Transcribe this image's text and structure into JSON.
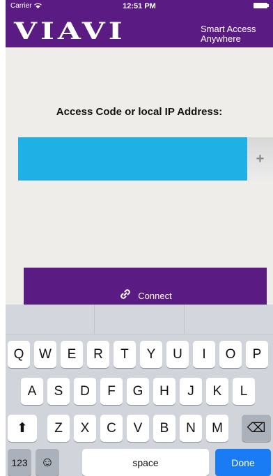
{
  "status_bar": {
    "carrier": "Carrier",
    "time": "12:51 PM"
  },
  "header": {
    "logo": "VIAVI",
    "tagline_line1": "Smart Access",
    "tagline_line2": "Anywhere"
  },
  "main": {
    "access_label": "Access Code or local IP Address:",
    "input_value": "",
    "add_button_label": "+",
    "connect_label": "Connect"
  },
  "keyboard": {
    "row1": [
      "Q",
      "W",
      "E",
      "R",
      "T",
      "Y",
      "U",
      "I",
      "O",
      "P"
    ],
    "row2": [
      "A",
      "S",
      "D",
      "F",
      "G",
      "H",
      "J",
      "K",
      "L"
    ],
    "row3": [
      "Z",
      "X",
      "C",
      "V",
      "B",
      "N",
      "M"
    ],
    "shift_symbol": "⬆",
    "delete_symbol": "⌫",
    "numbers_label": "123",
    "emoji_symbol": "☺",
    "space_label": "space",
    "done_label": "Done"
  },
  "colors": {
    "brand_purple": "#5a1b82",
    "input_blue": "#1fb0e6",
    "done_blue": "#1a7cf4"
  }
}
